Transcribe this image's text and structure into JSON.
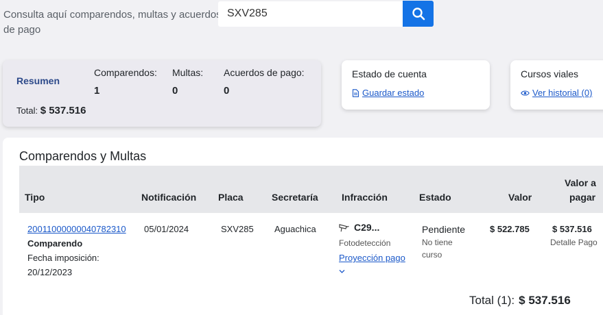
{
  "search": {
    "label": "Consulta aquí comparendos, multas y acuerdos de pago",
    "value": "SXV285"
  },
  "summary": {
    "title": "Resumen",
    "total_label": "Total:",
    "total_value": "$ 537.516",
    "counts": [
      {
        "label": "Comparendos:",
        "value": "1"
      },
      {
        "label": "Multas:",
        "value": "0"
      },
      {
        "label": "Acuerdos de pago:",
        "value": "0"
      }
    ]
  },
  "estado_cuenta": {
    "heading": "Estado de cuenta",
    "link": "Guardar estado"
  },
  "cursos": {
    "heading": "Cursos viales",
    "link": "Ver historial (0)"
  },
  "table": {
    "title": "Comparendos y Multas",
    "headers": {
      "tipo": "Tipo",
      "notificacion": "Notificación",
      "placa": "Placa",
      "secretaria": "Secretaría",
      "infraccion": "Infracción",
      "estado": "Estado",
      "valor": "Valor",
      "valor_pagar_1": "Valor a",
      "valor_pagar_2": "pagar"
    },
    "rows": [
      {
        "numero": "20011000000040782310",
        "tipo": "Comparendo",
        "fecha_label": "Fecha imposición:",
        "fecha": "20/12/2023",
        "notificacion": "05/01/2024",
        "placa": "SXV285",
        "secretaria": "Aguachica",
        "infraccion_code": "C29...",
        "infraccion_tipo": "Fotodetección",
        "proyeccion": "Proyección pago",
        "estado": "Pendiente",
        "curso_1": "No tiene",
        "curso_2": "curso",
        "valor": "$ 522.785",
        "valor_pagar": "$ 537.516",
        "detalle": "Detalle Pago"
      }
    ]
  },
  "footer": {
    "total_label": "Total (1):",
    "total_value": "$ 537.516"
  },
  "colors": {
    "accent": "#1473e6",
    "link": "#1a58c9",
    "summary_title": "#2d4a8a"
  }
}
